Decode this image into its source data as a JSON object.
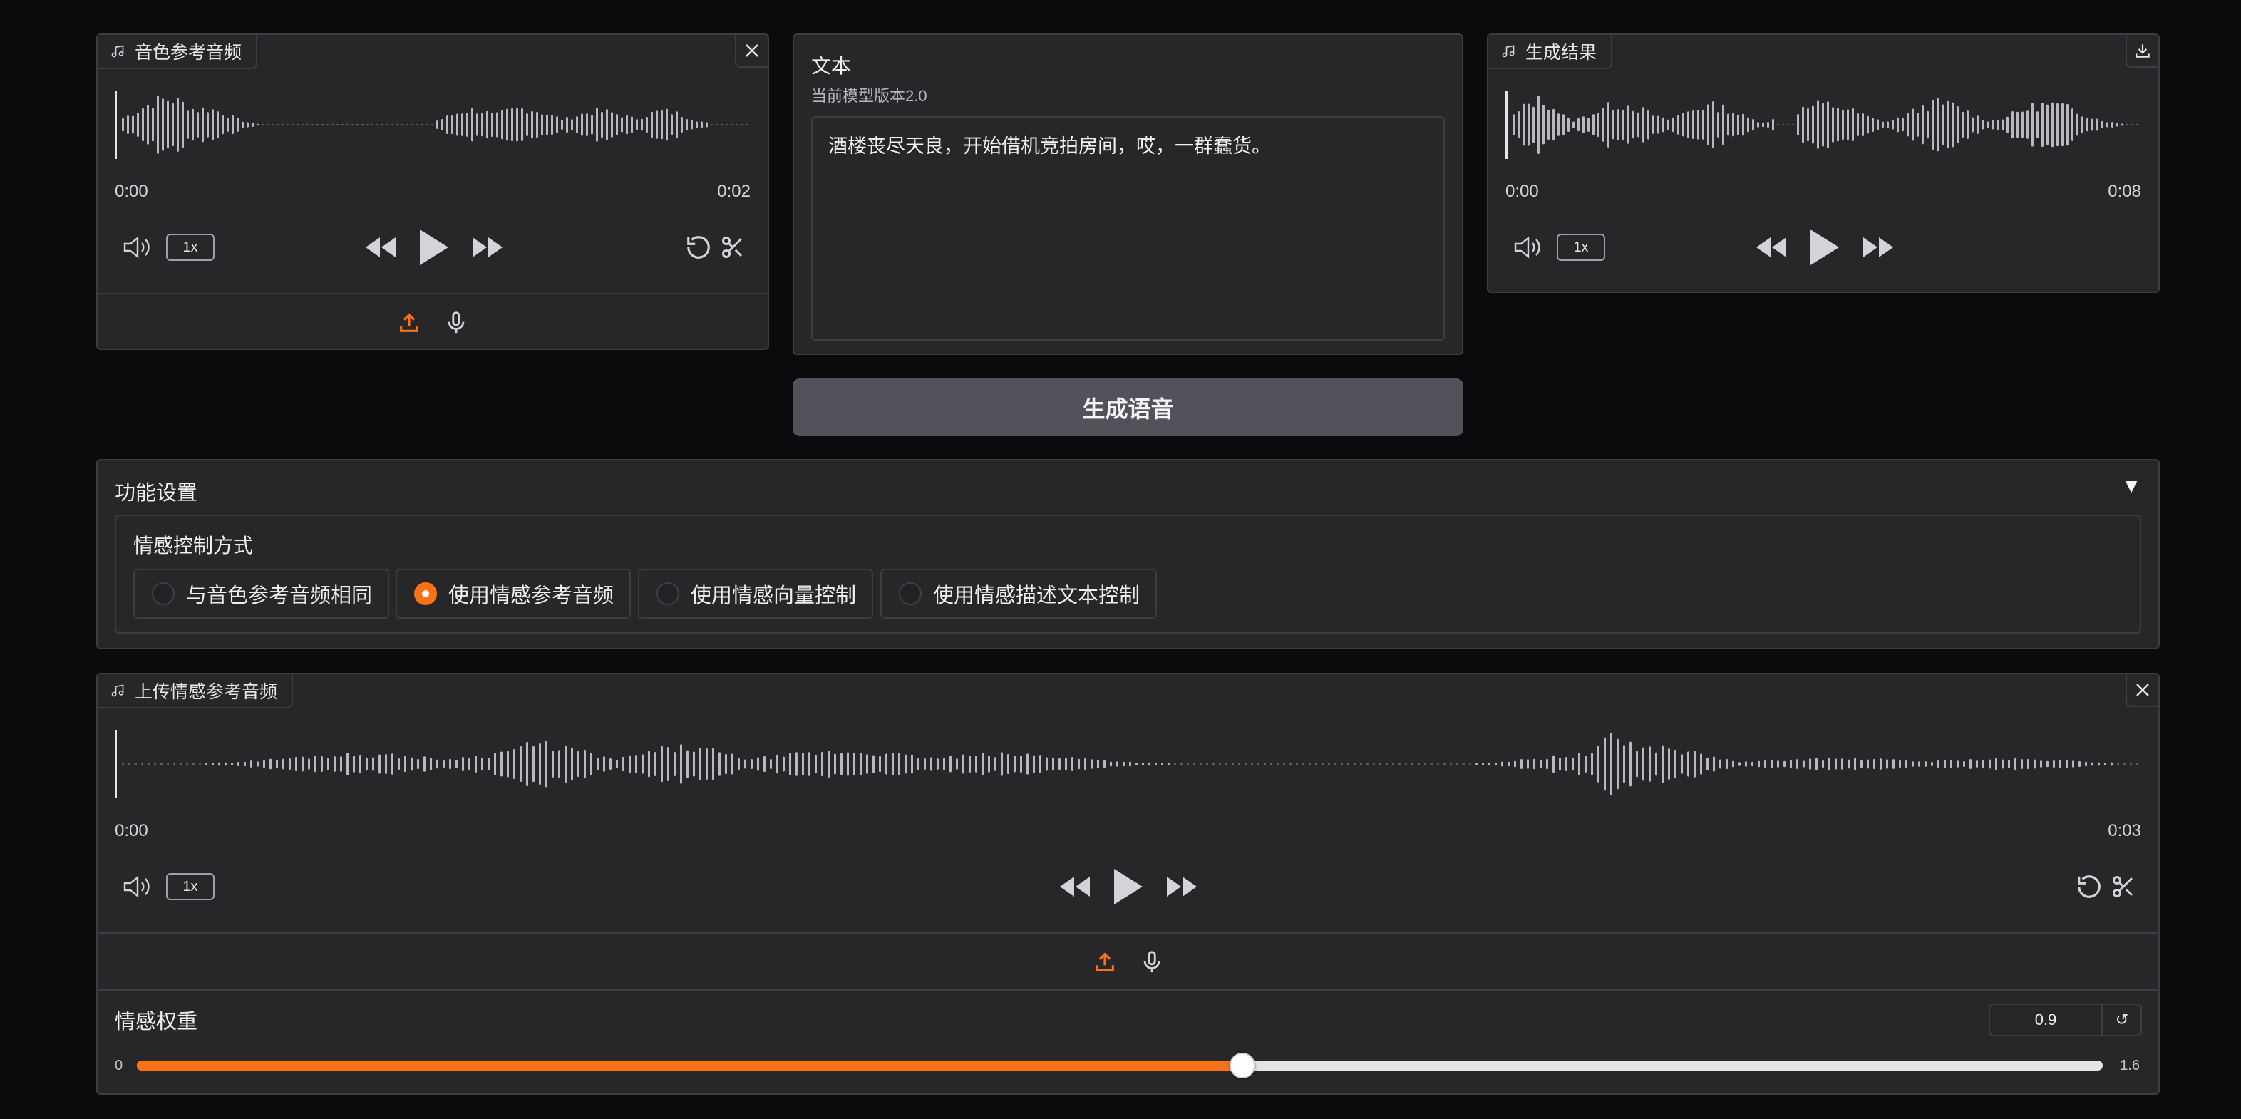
{
  "voice_ref": {
    "tag": "音色参考音频",
    "time_start": "0:00",
    "time_end": "0:02",
    "rate": "1x"
  },
  "text_panel": {
    "label": "文本",
    "sub": "当前模型版本2.0",
    "value": "酒楼丧尽天良，开始借机竞拍房间，哎，一群蠢货。"
  },
  "result": {
    "tag": "生成结果",
    "time_start": "0:00",
    "time_end": "0:08",
    "rate": "1x"
  },
  "generate_button": "生成语音",
  "settings": {
    "title": "功能设置",
    "collapse_glyph": "▼",
    "emotion_label": "情感控制方式",
    "options": [
      {
        "label": "与音色参考音频相同",
        "selected": false
      },
      {
        "label": "使用情感参考音频",
        "selected": true
      },
      {
        "label": "使用情感向量控制",
        "selected": false
      },
      {
        "label": "使用情感描述文本控制",
        "selected": false
      }
    ]
  },
  "emotion_ref": {
    "tag": "上传情感参考音频",
    "time_start": "0:00",
    "time_end": "0:03",
    "rate": "1x"
  },
  "weight": {
    "label": "情感权重",
    "value": "0.9",
    "min": "0",
    "max": "1.6",
    "reset_glyph": "↺"
  },
  "colors": {
    "accent": "#f97316",
    "panel": "#27272a",
    "background": "#0b0b0d",
    "button": "#52525b"
  }
}
